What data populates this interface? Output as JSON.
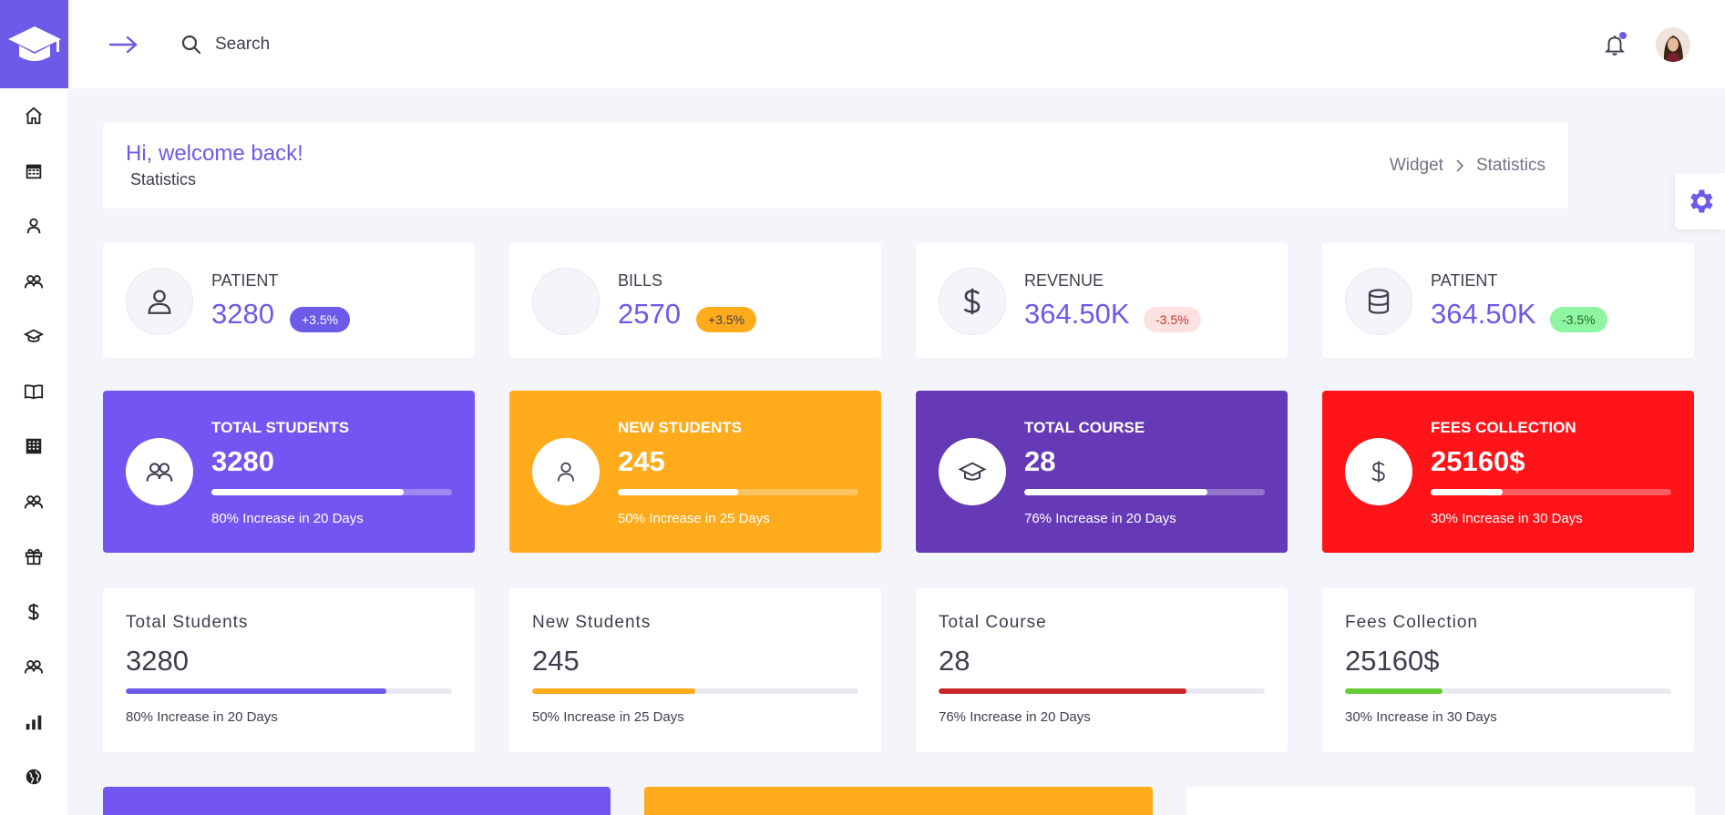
{
  "header": {
    "search_placeholder": "Search"
  },
  "welcome": {
    "title": "Hi, welcome back!",
    "subtitle": "Statistics",
    "breadcrumb": [
      "Widget",
      "Statistics"
    ]
  },
  "sidebar": {
    "items": [
      {
        "icon": "home-icon"
      },
      {
        "icon": "calendar-icon"
      },
      {
        "icon": "user-icon"
      },
      {
        "icon": "users-icon"
      },
      {
        "icon": "graduation-cap-icon"
      },
      {
        "icon": "book-icon"
      },
      {
        "icon": "building-icon"
      },
      {
        "icon": "users-icon"
      },
      {
        "icon": "gift-icon"
      },
      {
        "icon": "dollar-icon"
      },
      {
        "icon": "users-icon"
      },
      {
        "icon": "bar-chart-icon"
      },
      {
        "icon": "globe-icon"
      }
    ]
  },
  "stats": [
    {
      "label": "PATIENT",
      "value": "3280",
      "badge": "+3.5%",
      "icon": "user-icon",
      "badge_bg": "#6c5ae8",
      "badge_fg": "#ffffff"
    },
    {
      "label": "BILLS",
      "value": "2570",
      "badge": "+3.5%",
      "icon": "empty",
      "badge_bg": "#ffab1c",
      "badge_fg": "#3d3f4e"
    },
    {
      "label": "REVENUE",
      "value": "364.50K",
      "badge": "-3.5%",
      "icon": "dollar-icon",
      "badge_bg": "#fde0e0",
      "badge_fg": "#c0392b"
    },
    {
      "label": "PATIENT",
      "value": "364.50K",
      "badge": "-3.5%",
      "icon": "database-icon",
      "badge_bg": "#8ef5a0",
      "badge_fg": "#1e6b30"
    }
  ],
  "colored_cards": [
    {
      "label": "TOTAL STUDENTS",
      "value": "3280",
      "progress": 0.8,
      "note": "80% Increase in 20 Days",
      "bg": "#7355f1",
      "icon": "users-icon"
    },
    {
      "label": "NEW STUDENTS",
      "value": "245",
      "progress": 0.5,
      "note": "50% Increase in 25 Days",
      "bg": "#ffab1c",
      "icon": "user-icon"
    },
    {
      "label": "TOTAL COURSE",
      "value": "28",
      "progress": 0.76,
      "note": "76% Increase in 20 Days",
      "bg": "#663ab6",
      "icon": "graduation-cap-icon"
    },
    {
      "label": "FEES COLLECTION",
      "value": "25160$",
      "progress": 0.3,
      "note": "30% Increase in 30 Days",
      "bg": "#ff141a",
      "icon": "dollar-icon"
    }
  ],
  "white_cards": [
    {
      "label": "Total Students",
      "value": "3280",
      "progress": 0.8,
      "note": "80% Increase in 20 Days",
      "bar_color": "#6c5ae8"
    },
    {
      "label": "New Students",
      "value": "245",
      "progress": 0.5,
      "note": "50% Increase in 25 Days",
      "bar_color": "#ffab1c"
    },
    {
      "label": "Total Course",
      "value": "28",
      "progress": 0.76,
      "note": "76% Increase in 20 Days",
      "bar_color": "#c62828"
    },
    {
      "label": "Fees Collection",
      "value": "25160$",
      "progress": 0.3,
      "note": "30% Increase in 30 Days",
      "bar_color": "#66cc33"
    }
  ],
  "peek_colors": [
    "#7355f1",
    "#ffab1c",
    "#ffffff"
  ],
  "colors": {
    "accent": "#6c5ae8"
  }
}
